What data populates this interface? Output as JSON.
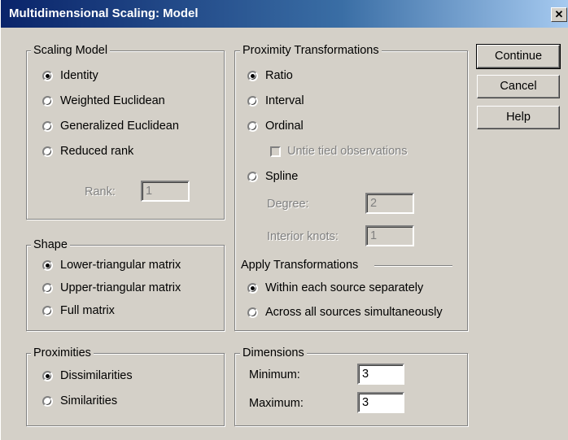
{
  "window": {
    "title": "Multidimensional Scaling: Model",
    "close_icon": "close-icon"
  },
  "scaling_model": {
    "legend": "Scaling Model",
    "options": [
      "Identity",
      "Weighted Euclidean",
      "Generalized Euclidean",
      "Reduced rank"
    ],
    "selected": "Identity",
    "rank_label": "Rank:",
    "rank_value": "1"
  },
  "shape": {
    "legend": "Shape",
    "options": [
      "Lower-triangular matrix",
      "Upper-triangular matrix",
      "Full matrix"
    ],
    "selected": "Lower-triangular matrix"
  },
  "proximities": {
    "legend": "Proximities",
    "options": [
      "Dissimilarities",
      "Similarities"
    ],
    "selected": "Dissimilarities"
  },
  "proximity_transformations": {
    "legend": "Proximity Transformations",
    "options": [
      "Ratio",
      "Interval",
      "Ordinal",
      "Spline"
    ],
    "selected": "Ratio",
    "untie_label": "Untie tied observations",
    "degree_label": "Degree:",
    "degree_value": "2",
    "knots_label": "Interior knots:",
    "knots_value": "1"
  },
  "apply_transformations": {
    "label": "Apply Transformations",
    "options": [
      "Within each source separately",
      "Across all sources simultaneously"
    ],
    "selected": "Within each source separately"
  },
  "dimensions": {
    "legend": "Dimensions",
    "min_label": "Minimum:",
    "min_value": "3",
    "max_label": "Maximum:",
    "max_value": "3"
  },
  "buttons": {
    "continue": "Continue",
    "cancel": "Cancel",
    "help": "Help"
  }
}
